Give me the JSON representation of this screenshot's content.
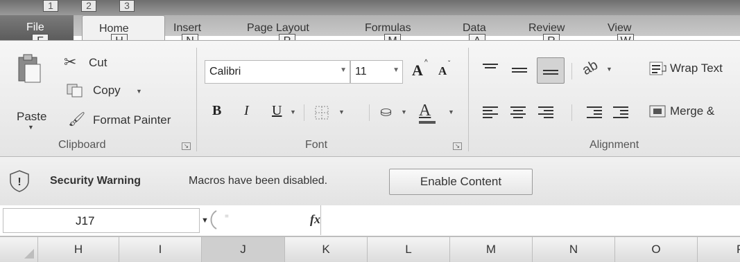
{
  "qat_keytips": [
    "1",
    "2",
    "3"
  ],
  "tabs": {
    "file": {
      "label": "File",
      "keytip": "F"
    },
    "home": {
      "label": "Home",
      "keytip": "H"
    },
    "insert": {
      "label": "Insert",
      "keytip": "N"
    },
    "page_layout": {
      "label": "Page Layout",
      "keytip": "P"
    },
    "formulas": {
      "label": "Formulas",
      "keytip": "M"
    },
    "data": {
      "label": "Data",
      "keytip": "A"
    },
    "review": {
      "label": "Review",
      "keytip": "R"
    },
    "view": {
      "label": "View",
      "keytip": "W"
    }
  },
  "clipboard": {
    "paste": "Paste",
    "cut": "Cut",
    "copy": "Copy",
    "format_painter": "Format Painter",
    "group_label": "Clipboard"
  },
  "font": {
    "name": "Calibri",
    "size": "11",
    "grow": "A",
    "shrink": "A",
    "bold": "B",
    "italic": "I",
    "underline": "U",
    "font_color": "A",
    "group_label": "Font"
  },
  "alignment": {
    "wrap_text": "Wrap Text",
    "merge": "Merge &",
    "group_label": "Alignment"
  },
  "security": {
    "title": "Security Warning",
    "message": "Macros have been disabled.",
    "button": "Enable Content"
  },
  "formula_bar": {
    "name_box": "J17",
    "fx": "fx",
    "formula": ""
  },
  "columns": [
    "H",
    "I",
    "J",
    "K",
    "L",
    "M",
    "N",
    "O",
    "P"
  ],
  "colors": {
    "file_tab": "#6a6a6a",
    "ribbon_bg": "#eeeeee",
    "security_bar": "#ebebeb"
  }
}
